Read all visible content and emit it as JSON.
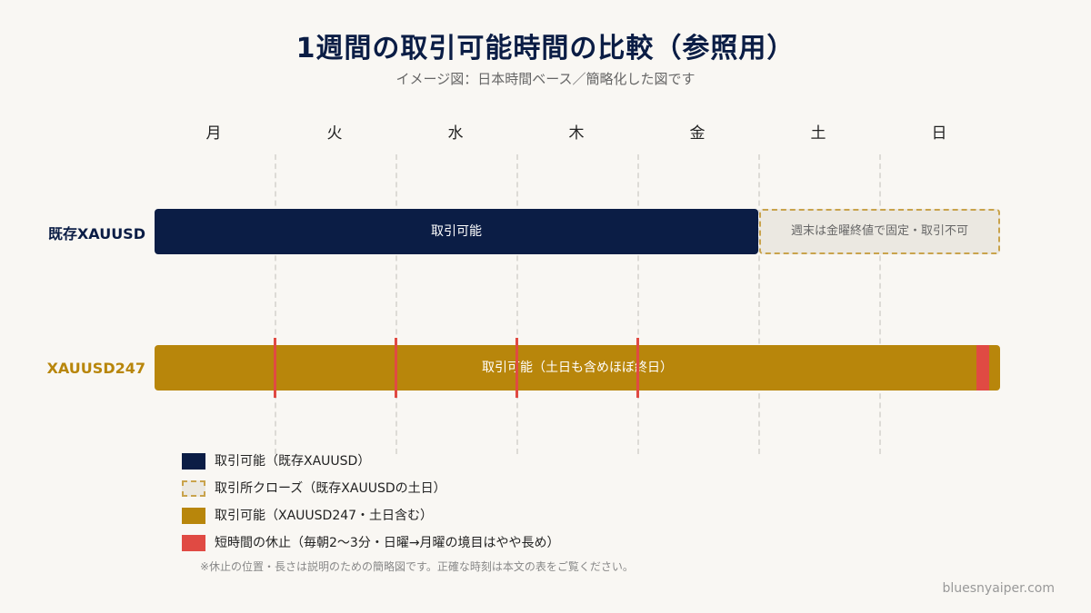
{
  "title": "1週間の取引可能時間の比較（参照用）",
  "subtitle": "イメージ図：日本時間ベース／簡略化した図です",
  "days": [
    "月",
    "火",
    "水",
    "木",
    "金",
    "土",
    "日"
  ],
  "rows": {
    "xauusd": {
      "label": "既存XAUUSD",
      "bar_label": "取引可能",
      "weekend_label": "週末は金曜終値で固定・取引不可"
    },
    "xauusd247": {
      "label": "XAUUSD247",
      "bar_label": "取引可能（土日も含めほぼ終日）"
    }
  },
  "legend": [
    {
      "text": "取引可能（既存XAUUSD）"
    },
    {
      "text": "取引所クローズ（既存XAUUSDの土日）"
    },
    {
      "text": "取引可能（XAUUSD247・土日含む）"
    },
    {
      "text": "短時間の休止（毎朝2〜3分・日曜→月曜の境目はやや長め）"
    }
  ],
  "legend_note": "※休止の位置・長さは説明のための簡略図です。正確な時刻は本文の表をご覧ください。",
  "watermark": "bluesnyaiper.com",
  "colors": {
    "navy": "#0b1d45",
    "gold": "#b8860b",
    "red": "#e04a43",
    "closed_fill": "#ebe8e1",
    "closed_border": "#c9a34c"
  }
}
